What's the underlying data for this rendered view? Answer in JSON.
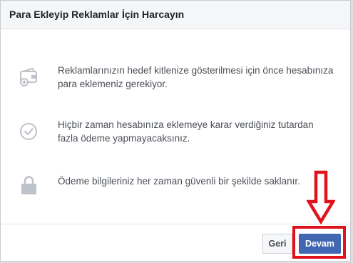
{
  "dialog": {
    "title": "Para Ekleyip Reklamlar İçin Harcayın"
  },
  "items": [
    {
      "icon": "wallet-icon",
      "text": "Reklamlarınızın hedef kitlenize gösterilmesi için önce hesabınıza para eklemeniz gerekiyor."
    },
    {
      "icon": "checkmark-circle-icon",
      "text": "Hiçbir zaman hesabınıza eklemeye karar verdiğiniz tutardan fazla ödeme yapmayacaksınız."
    },
    {
      "icon": "lock-icon",
      "text": "Ödeme bilgileriniz her zaman güvenli bir şekilde saklanır."
    }
  ],
  "footer": {
    "back_label": "Geri",
    "continue_label": "Devam"
  },
  "colors": {
    "primary_button": "#4267b2",
    "annotation_red": "#e0121b",
    "icon_gray": "#bec2c9"
  }
}
